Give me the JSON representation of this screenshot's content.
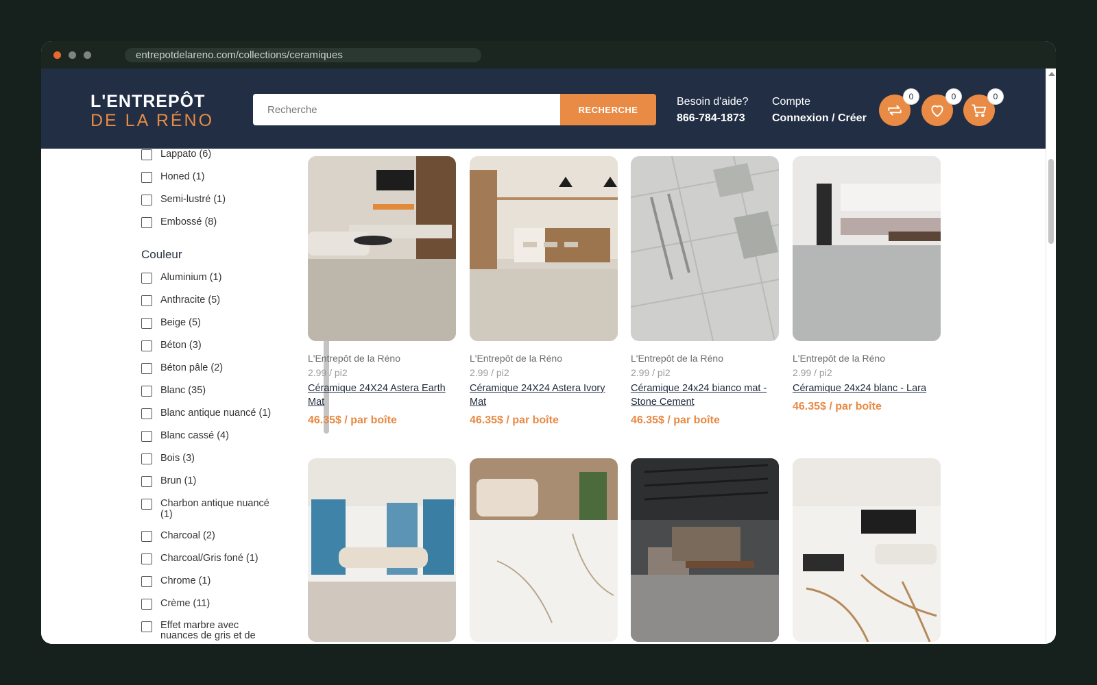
{
  "browser": {
    "url": "entrepotdelareno.com/collections/ceramiques"
  },
  "header": {
    "logo_line1": "L'ENTREPÔT",
    "logo_line2": "DE LA RÉNO",
    "search_placeholder": "Recherche",
    "search_button": "RECHERCHE",
    "help_label": "Besoin d'aide?",
    "help_phone": "866-784-1873",
    "account_label": "Compte",
    "account_action": "Connexion / Créer",
    "compare_count": "0",
    "wishlist_count": "0",
    "cart_count": "0",
    "accent": "#e98a45",
    "navy": "#212e44"
  },
  "filters": {
    "finish_items": [
      "Lappato (6)",
      "Honed (1)",
      "Semi-lustré (1)",
      "Embossé (8)"
    ],
    "color_title": "Couleur",
    "color_items": [
      "Aluminium (1)",
      "Anthracite (5)",
      "Beige (5)",
      "Béton (3)",
      "Béton pâle (2)",
      "Blanc (35)",
      "Blanc antique nuancé (1)",
      "Blanc cassé (4)",
      "Bois (3)",
      "Brun (1)",
      "Charbon antique nuancé (1)",
      "Charcoal (2)",
      "Charcoal/Gris foné (1)",
      "Chrome (1)",
      "Crème (11)",
      "Effet marbre avec nuances de gris et de"
    ]
  },
  "products": [
    {
      "brand": "L'Entrepôt de la Réno",
      "unit": "2.99 / pi2",
      "name": "Céramique 24X24 Astera Earth Mat",
      "price": "46.35$ / par boîte"
    },
    {
      "brand": "L'Entrepôt de la Réno",
      "unit": "2.99 / pi2",
      "name": "Céramique 24X24 Astera Ivory Mat",
      "price": "46.35$ / par boîte"
    },
    {
      "brand": "L'Entrepôt de la Réno",
      "unit": "2.99 / pi2",
      "name": "Céramique 24x24 bianco mat - Stone Cement",
      "price": "46.35$ / par boîte"
    },
    {
      "brand": "L'Entrepôt de la Réno",
      "unit": "2.99 / pi2",
      "name": "Céramique 24x24 blanc - Lara",
      "price": "46.35$ / par boîte"
    }
  ]
}
